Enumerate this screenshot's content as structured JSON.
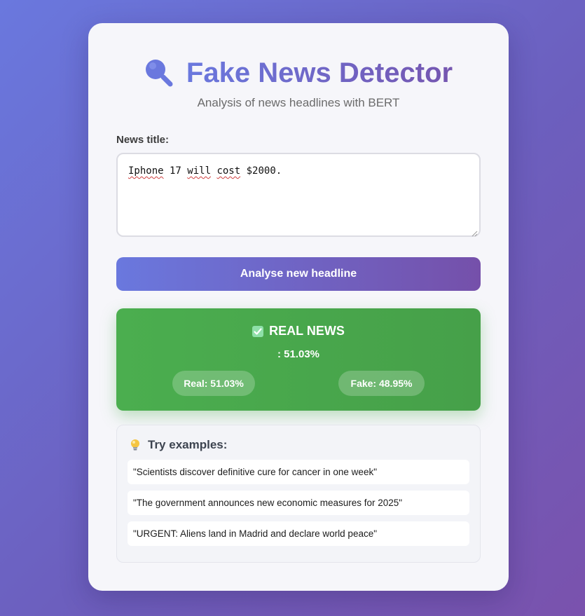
{
  "header": {
    "icon": "magnifier-icon",
    "title": "Fake News Detector",
    "subtitle": "Analysis of news headlines with BERT"
  },
  "form": {
    "label": "News title:",
    "input_words": [
      "Iphone",
      " 17 ",
      "will",
      " ",
      "cost",
      " $2000."
    ],
    "button_label": "Analyse new headline"
  },
  "result": {
    "icon": "check-icon",
    "verdict": "REAL NEWS",
    "confidence": ": 51.03%",
    "real_label": "Real: 51.03%",
    "fake_label": "Fake: 48.95%",
    "color": "#4caf50"
  },
  "examples": {
    "icon": "lightbulb-icon",
    "title": "Try examples:",
    "items": [
      "\"Scientists discover definitive cure for cancer in one week\"",
      "\"The government announces new economic measures for 2025\"",
      "\"URGENT: Aliens land in Madrid and declare world peace\""
    ]
  },
  "colors": {
    "accent_start": "#6a78de",
    "accent_end": "#7550aa",
    "real_green": "#4caf50"
  }
}
